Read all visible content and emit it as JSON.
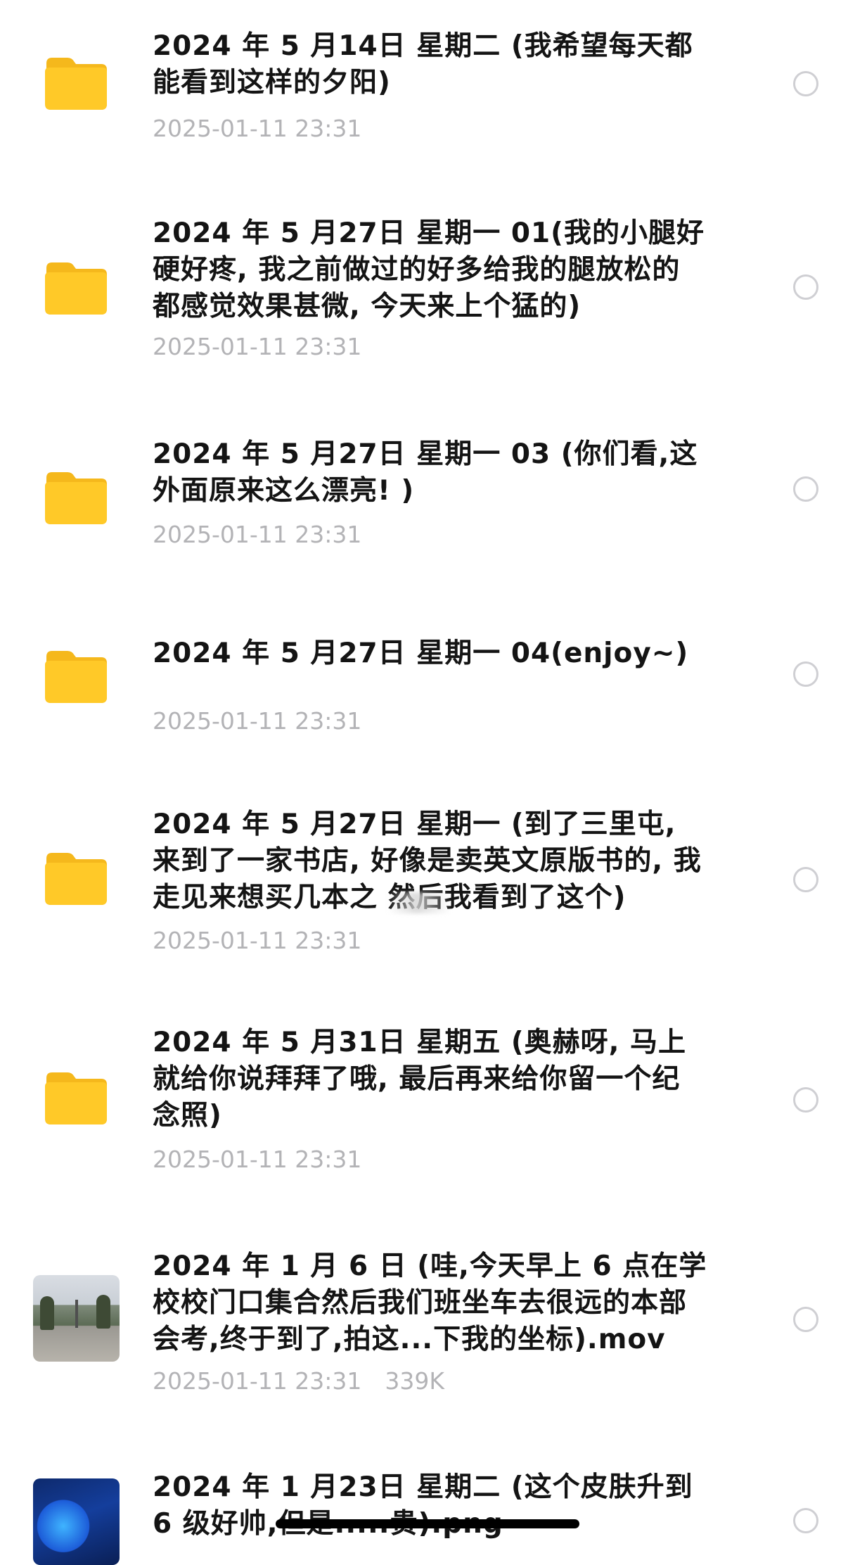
{
  "items": [
    {
      "title": "2024 年 5 月14日 星期二 (我希望每天都能看到这样的夕阳)",
      "meta": "2025-01-11 23:31",
      "type": "folder-icon"
    },
    {
      "title": "2024 年 5 月27日 星期一 01(我的小腿好硬好疼, 我之前做过的好多给我的腿放松的都感觉效果甚微, 今天来上个猛的)",
      "meta": "2025-01-11 23:31",
      "type": "folder-icon"
    },
    {
      "title": "2024 年 5 月27日 星期一 03 (你们看,这外面原来这么漂亮! )",
      "meta": "2025-01-11 23:31",
      "type": "folder-icon"
    },
    {
      "title": "2024 年 5 月27日 星期一 04(enjoy~)",
      "meta": "2025-01-11 23:31",
      "type": "folder-icon"
    },
    {
      "title": "2024 年 5 月27日 星期一 (到了三里屯, 来到了一家书店, 好像是卖英文原版书的, 我走见来想买几本之 然后我看到了这个)",
      "meta": "2025-01-11 23:31",
      "type": "folder-icon"
    },
    {
      "title": "2024 年 5 月31日 星期五 (奥赫呀, 马上就给你说拜拜了哦, 最后再来给你留一个纪念照)",
      "meta": "2025-01-11 23:31",
      "type": "folder-icon"
    },
    {
      "title": "2024 年 1 月 6 日 (哇,今天早上 6 点在学校校门口集合然后我们班坐车去很远的本部会考,终于到了,拍这...下我的坐标).mov",
      "meta": "2025-01-11 23:31",
      "size": "339K",
      "type": "video-thumbnail"
    },
    {
      "title": "2024 年 1 月23日 星期二 (这个皮肤升到 6 级好帅,但是.....贵).png",
      "meta": "",
      "type": "image-thumbnail"
    }
  ],
  "colors": {
    "folder": "#FFC928",
    "folder_tab": "#F5B81C",
    "title": "#141414",
    "meta": "#B3B3B6",
    "radio_border": "#CFCFD3",
    "home_indicator": "#000000"
  }
}
